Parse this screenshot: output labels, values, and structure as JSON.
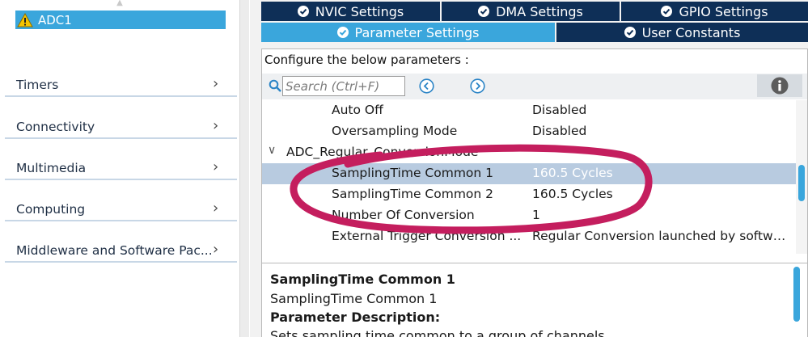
{
  "sidebar": {
    "selected_item": "ADC1",
    "categories": [
      {
        "label": "Timers"
      },
      {
        "label": "Connectivity"
      },
      {
        "label": "Multimedia"
      },
      {
        "label": "Computing"
      },
      {
        "label": "Middleware and Software Pac..."
      }
    ]
  },
  "tabs": {
    "row1": [
      {
        "label": "NVIC Settings"
      },
      {
        "label": "DMA Settings"
      },
      {
        "label": "GPIO Settings"
      }
    ],
    "row2": [
      {
        "label": "Parameter Settings",
        "active": true
      },
      {
        "label": "User Constants",
        "active": false
      }
    ]
  },
  "panel": {
    "caption": "Configure the below parameters :",
    "search_placeholder": "Search (Ctrl+F)"
  },
  "tree": {
    "rows": [
      {
        "name": "Auto Off",
        "value": "Disabled"
      },
      {
        "name": "Oversampling Mode",
        "value": "Disabled"
      },
      {
        "name": "ADC_Regular_ConversionMode",
        "value": "",
        "group": true,
        "expanded": true
      },
      {
        "name": "SamplingTime Common 1",
        "value": "160.5 Cycles",
        "selected": true
      },
      {
        "name": "SamplingTime Common 2",
        "value": "160.5 Cycles"
      },
      {
        "name": "Number Of Conversion",
        "value": "1"
      },
      {
        "name": "External Trigger Conversion ...",
        "value": "Regular Conversion launched by softwa..."
      }
    ]
  },
  "description": {
    "title": "SamplingTime Common 1",
    "subtitle": "SamplingTime Common 1",
    "heading": "Parameter Description:",
    "body": "Sets sampling time common to a group of channels."
  },
  "icons": {
    "warning": "warning-icon",
    "check": "check-circle-icon",
    "search": "search-icon",
    "prev": "previous-icon",
    "next": "next-icon",
    "info": "info-icon",
    "chevron": "chevron-right-icon"
  },
  "colors": {
    "accent": "#3aa6dc",
    "tab_dark": "#0e2f57",
    "selection": "#b8cbe0",
    "annotation": "#c41e5e"
  }
}
